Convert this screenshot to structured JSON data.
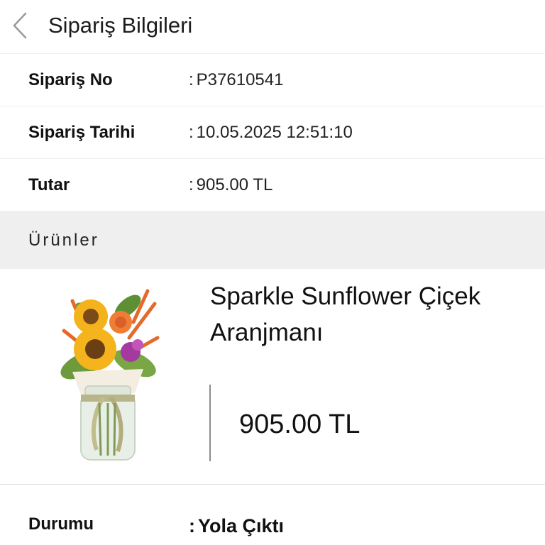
{
  "header": {
    "title": "Sipariş Bilgileri"
  },
  "order": {
    "number_label": "Sipariş No",
    "number_value": "P37610541",
    "date_label": "Sipariş Tarihi",
    "date_value": "10.05.2025 12:51:10",
    "amount_label": "Tutar",
    "amount_value": "905.00 TL",
    "separator": ":"
  },
  "products_section": {
    "title": "Ürünler"
  },
  "product": {
    "name": "Sparkle Sunflower Çiçek Aranjmanı",
    "price": "905.00 TL",
    "image": "sunflower-bouquet-in-jar"
  },
  "status": {
    "label": "Durumu",
    "value": "Yola Çıktı",
    "separator": ":"
  }
}
